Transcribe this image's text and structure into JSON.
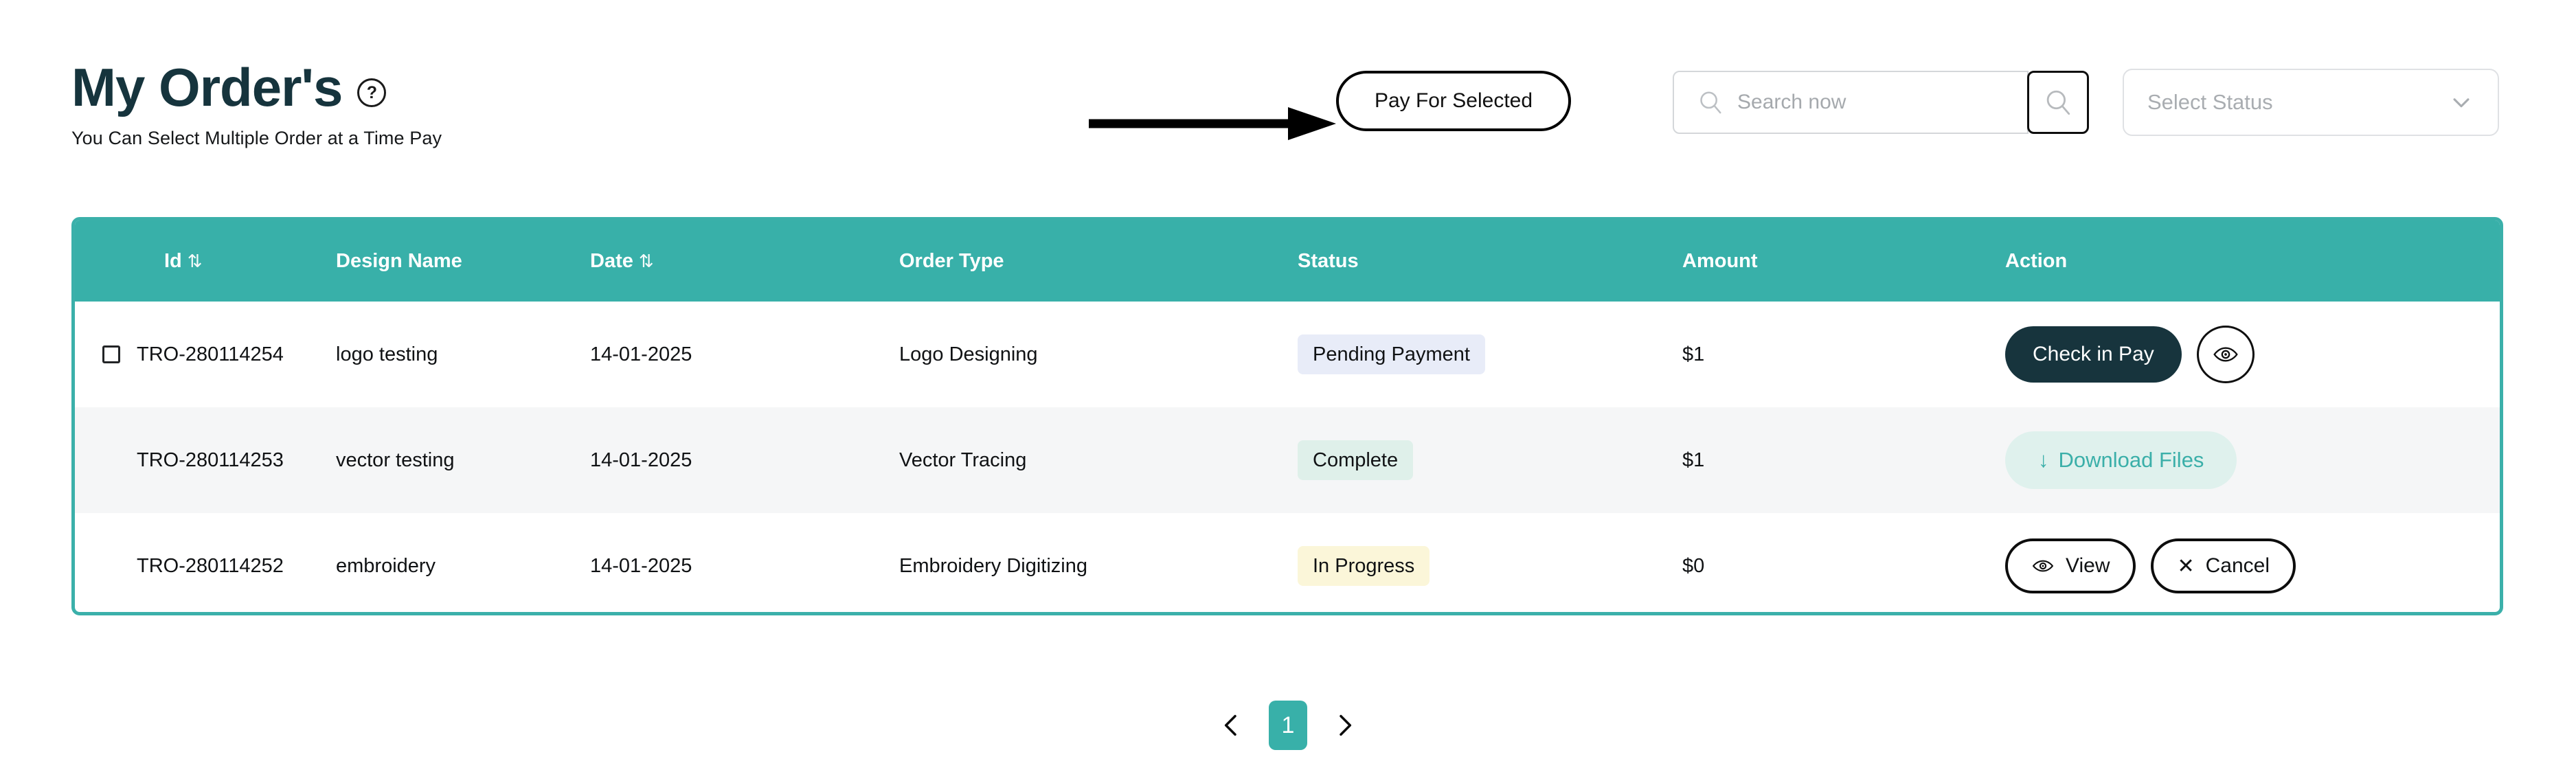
{
  "header": {
    "title": "My Order's",
    "help_icon": "question-mark-circle-icon",
    "subtitle": "You Can Select Multiple Order at a Time Pay",
    "pay_button_label": "Pay For Selected",
    "annotation_arrow": "arrow-pointing-right"
  },
  "search": {
    "placeholder": "Search now",
    "value": "",
    "leading_icon": "search-icon",
    "button_icon": "search-icon"
  },
  "status_filter": {
    "label": "Select Status",
    "chevron_icon": "chevron-down-icon"
  },
  "table": {
    "columns": [
      {
        "label": "Id",
        "sortable": true,
        "sort_icon": "⇅"
      },
      {
        "label": "Design Name",
        "sortable": false,
        "sort_icon": ""
      },
      {
        "label": "Date",
        "sortable": true,
        "sort_icon": "⇅"
      },
      {
        "label": "Order Type",
        "sortable": false,
        "sort_icon": ""
      },
      {
        "label": "Status",
        "sortable": false,
        "sort_icon": ""
      },
      {
        "label": "Amount",
        "sortable": false,
        "sort_icon": ""
      },
      {
        "label": "Action",
        "sortable": false,
        "sort_icon": ""
      }
    ],
    "rows": [
      {
        "checkbox": true,
        "id": "TRO-280114254",
        "design_name": "logo testing",
        "date": "14-01-2025",
        "order_type": "Logo Designing",
        "status": "Pending Payment",
        "amount": "$1",
        "actions": {
          "primary": "Check in Pay",
          "secondary_icon": "eye-icon"
        }
      },
      {
        "checkbox": false,
        "id": "TRO-280114253",
        "design_name": "vector testing",
        "date": "14-01-2025",
        "order_type": "Vector Tracing",
        "status": "Complete",
        "amount": "$1",
        "actions": {
          "download": "Download Files",
          "download_icon": "↓"
        }
      },
      {
        "checkbox": false,
        "id": "TRO-280114252",
        "design_name": "embroidery",
        "date": "14-01-2025",
        "order_type": "Embroidery Digitizing",
        "status": "In Progress",
        "amount": "$0",
        "actions": {
          "view": "View",
          "view_icon": "eye-icon",
          "cancel": "Cancel",
          "cancel_icon": "✕"
        }
      }
    ]
  },
  "pagination": {
    "prev_icon": "chevron-left-icon",
    "current_page": "1",
    "next_icon": "chevron-right-icon"
  },
  "colors": {
    "teal": "#38b0a9",
    "dark": "#17343d",
    "badge_pending_bg": "#e8ecf8",
    "badge_complete_bg": "#dff0ea",
    "badge_progress_bg": "#fbf6d9",
    "download_bg": "#dff1ed",
    "row_alt_bg": "#f5f6f7"
  }
}
